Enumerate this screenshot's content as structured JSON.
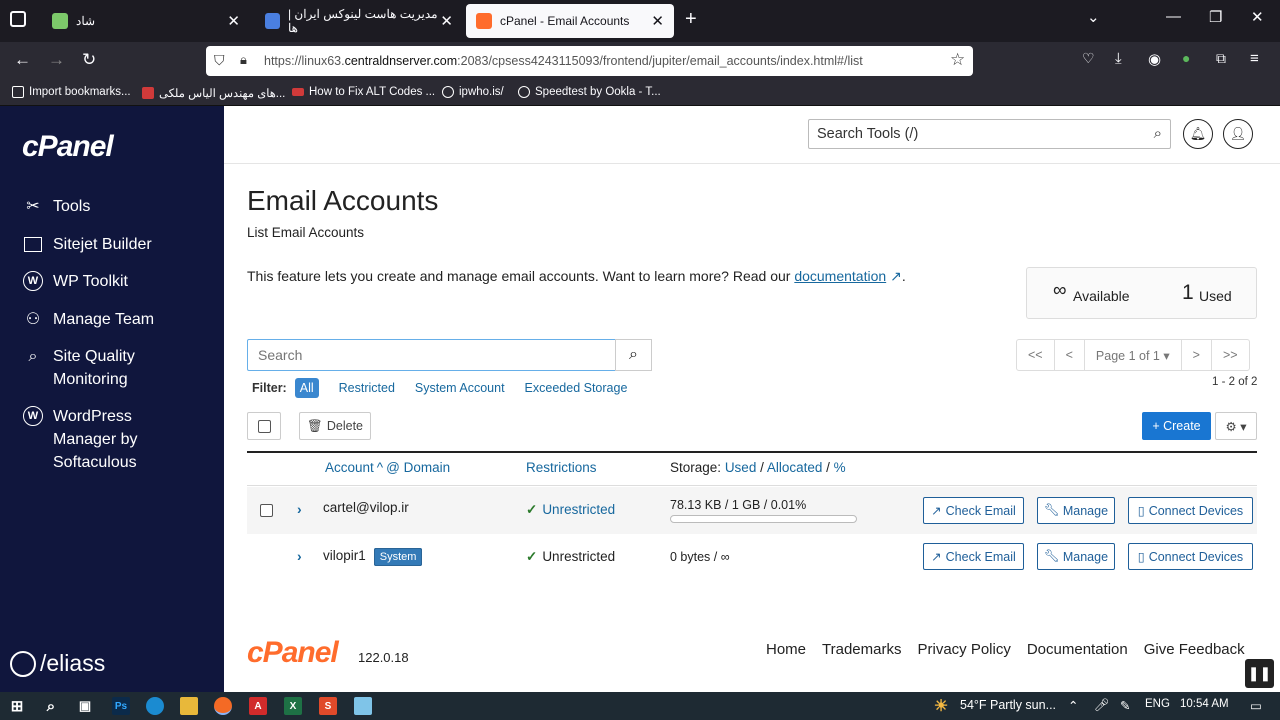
{
  "browser": {
    "tabs": [
      {
        "label": "شاد",
        "active": false
      },
      {
        "label": "مدیریت هاست لینوکس ایران | ها",
        "active": false
      },
      {
        "label": "cPanel - Email Accounts",
        "active": true
      }
    ],
    "url_prefix": "https://linux63.",
    "url_domain": "centraldnserver.com",
    "url_rest": ":2083/cpsess4243115093/frontend/jupiter/email_accounts/index.html#/list",
    "bookmarks": [
      "Import bookmarks...",
      "های مهندس الیاس ملکی...",
      "How to Fix ALT Codes ...",
      "ipwho.is/",
      "Speedtest by Ookla - T..."
    ]
  },
  "sidebar": {
    "logo": "cPanel",
    "items": [
      {
        "label": "Tools",
        "icon": "tools-icon"
      },
      {
        "label": "Sitejet Builder",
        "icon": "sitejet-icon"
      },
      {
        "label": "WP Toolkit",
        "icon": "wordpress-icon"
      },
      {
        "label": "Manage Team",
        "icon": "team-icon"
      },
      {
        "label": "Site Quality Monitoring",
        "icon": "site-quality-icon"
      },
      {
        "label": "WordPress Manager by Softaculous",
        "icon": "wordpress-icon"
      }
    ],
    "watermark": "/eliass"
  },
  "header": {
    "search_placeholder": "Search Tools (/)"
  },
  "page": {
    "title": "Email Accounts",
    "subtitle": "List Email Accounts",
    "description": "This feature lets you create and manage email accounts. Want to learn more? Read our ",
    "doc_link": "documentation",
    "desc_end": ".",
    "stats": {
      "available_symbol": "∞",
      "available_label": "Available",
      "used_count": "1",
      "used_label": "Used"
    }
  },
  "toolbar": {
    "search_placeholder": "Search",
    "filter_label": "Filter:",
    "filters": [
      "All",
      "Restricted",
      "System Account",
      "Exceeded Storage"
    ],
    "pager": {
      "first": "<<",
      "prev": "<",
      "page": "Page 1 of 1 ▾",
      "next": ">",
      "last": ">>"
    },
    "count": "1 - 2 of 2",
    "delete_label": "Delete",
    "create_label": "+ Create"
  },
  "table": {
    "col_account": "Account",
    "col_domain": "@ Domain",
    "col_restrictions": "Restrictions",
    "col_storage": "Storage:",
    "col_used": "Used",
    "col_allocated": "Allocated",
    "col_percent": "%",
    "rows": [
      {
        "account": "cartel@vilop.ir",
        "badge": "",
        "restriction": "Unrestricted",
        "storage": "78.13 KB / 1 GB / 0.01%",
        "usage_percent": 0.01
      },
      {
        "account": "vilopir1",
        "badge": "System",
        "restriction": "Unrestricted",
        "storage": "0 bytes / ∞",
        "usage_percent": 0
      }
    ],
    "actions": {
      "check_email": "Check Email",
      "manage": "Manage",
      "connect": "Connect Devices"
    }
  },
  "footer": {
    "logo": "cPanel",
    "version": "122.0.18",
    "links": [
      "Home",
      "Trademarks",
      "Privacy Policy",
      "Documentation",
      "Give Feedback"
    ]
  },
  "taskbar": {
    "weather": "54°F  Partly sun...",
    "lang": "ENG",
    "time": "10:54 AM"
  },
  "colors": {
    "sidebar": "#10163d",
    "accent": "#1976d2",
    "brand_orange": "#ff6c2c",
    "link": "#17689e"
  }
}
